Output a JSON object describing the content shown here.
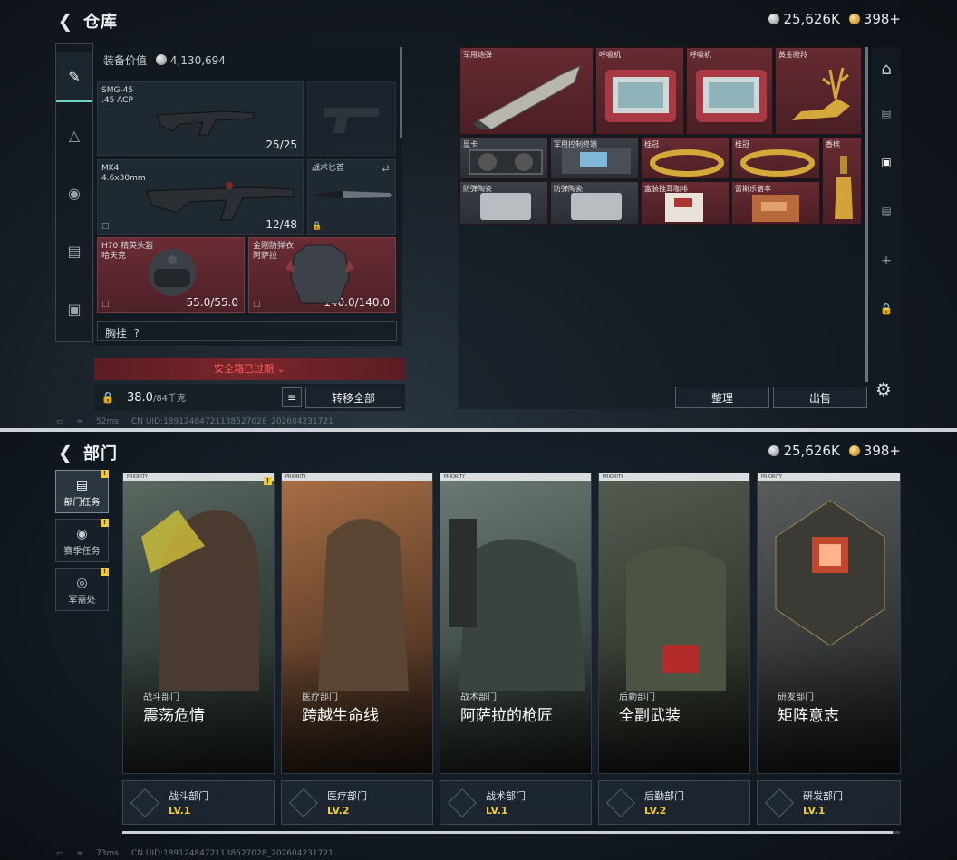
{
  "warehouse": {
    "title": "仓库",
    "silver": "25,626K",
    "gold": "398",
    "gold_plus": "+",
    "equip_value_label": "装备价值",
    "equip_value": "4,130,694",
    "slots": [
      {
        "name": "SMG-45\n.45 ACP",
        "value": "25/25"
      },
      {
        "name": "MK4\n4.6x30mm",
        "value": "12/48"
      },
      {
        "name": "战术匕首",
        "value": ""
      },
      {
        "name": "H70 精英头盔\n哈夫克",
        "value": "55.0/55.0"
      },
      {
        "name": "金刚防弹衣\n阿萨拉",
        "value": "140.0/140.0"
      }
    ],
    "chest_label": "胸挂",
    "chest_hint": "?",
    "expired": "安全箱已过期",
    "weight": "38.0",
    "weight_max": "/84千克",
    "transfer_all": "转移全部",
    "sort": "整理",
    "sell": "出售",
    "items": [
      "军用炮弹",
      "呼吸机",
      "呼吸机",
      "黄金瞪羚",
      "显卡",
      "军用控制终端",
      "桂冠",
      "桂冠",
      "香槟",
      "防弹陶瓷",
      "防弹陶瓷",
      "盒装挂耳咖啡",
      "雷斯乐谱本"
    ],
    "status": {
      "ping": "52ms",
      "uid": "CN UID:189124847211385270​28_202604231721"
    }
  },
  "department": {
    "title": "部门",
    "silver": "25,626K",
    "gold": "398",
    "gold_plus": "+",
    "nav": [
      {
        "label": "部门任务",
        "badge": "!"
      },
      {
        "label": "赛季任务",
        "badge": "!"
      },
      {
        "label": "军需处",
        "badge": "!"
      }
    ],
    "cards": [
      {
        "dept": "战斗部门",
        "title": "震荡危情",
        "lvl_name": "战斗部门",
        "lvl": "LV.1"
      },
      {
        "dept": "医疗部门",
        "title": "跨越生命线",
        "lvl_name": "医疗部门",
        "lvl": "LV.2"
      },
      {
        "dept": "战术部门",
        "title": "阿萨拉的枪匠",
        "lvl_name": "战术部门",
        "lvl": "LV.1"
      },
      {
        "dept": "后勤部门",
        "title": "全副武装",
        "lvl_name": "后勤部门",
        "lvl": "LV.2"
      },
      {
        "dept": "研发部门",
        "title": "矩阵意志",
        "lvl_name": "研发部门",
        "lvl": "LV.1"
      }
    ],
    "card_tag": "PRIORITY",
    "card_badge": "!",
    "status": {
      "ping": "73ms",
      "uid": "CN UID:18912484721138527028_202604231721"
    }
  }
}
